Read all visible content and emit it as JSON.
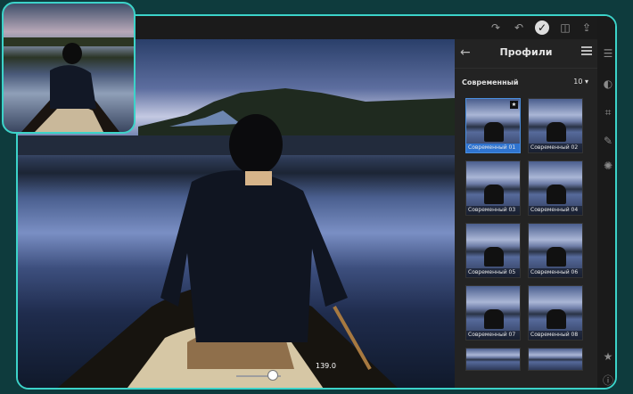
{
  "panel": {
    "title": "Профили",
    "group_label": "Современный",
    "group_count": "10 ▾",
    "profiles": [
      {
        "label": "Современный 01",
        "selected": true
      },
      {
        "label": "Современный 02"
      },
      {
        "label": "Современный 03"
      },
      {
        "label": "Современный 04"
      },
      {
        "label": "Современный 05"
      },
      {
        "label": "Современный 06"
      },
      {
        "label": "Современный 07"
      },
      {
        "label": "Современный 08"
      }
    ]
  },
  "slider": {
    "value": "139.0"
  },
  "colors": {
    "accent": "#3cd3c9",
    "selected": "#2f74d0"
  }
}
